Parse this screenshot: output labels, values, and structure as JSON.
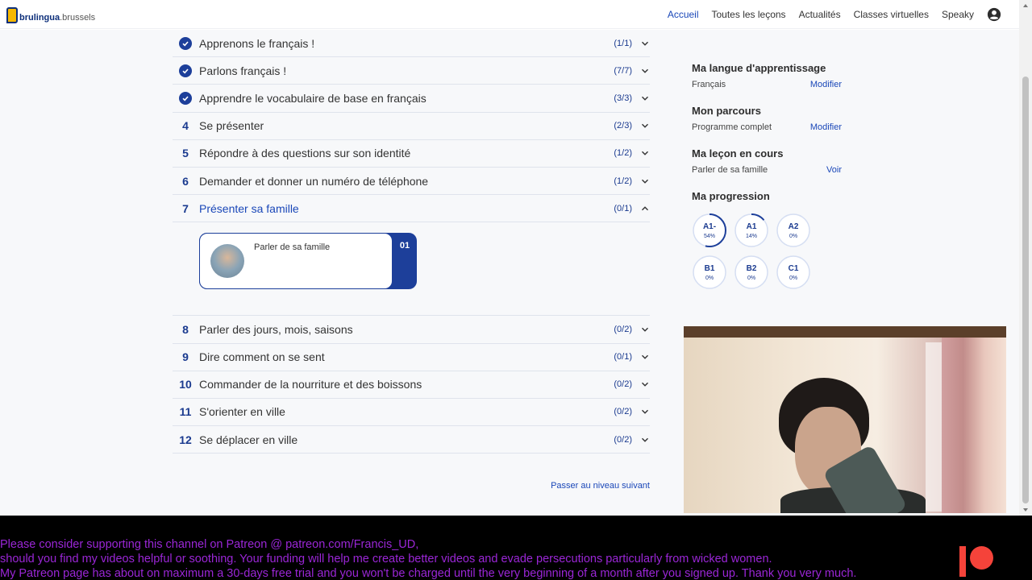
{
  "header": {
    "logo_name": "brulingua",
    "logo_suffix": ".brussels",
    "nav": [
      {
        "label": "Accueil",
        "active": true
      },
      {
        "label": "Toutes les leçons",
        "active": false
      },
      {
        "label": "Actualités",
        "active": false
      },
      {
        "label": "Classes virtuelles",
        "active": false
      },
      {
        "label": "Speaky",
        "active": false
      }
    ],
    "user_icon": "account-circle-icon"
  },
  "lessons": [
    {
      "num": "",
      "done": true,
      "title": "Apprenons le français !",
      "count": "(1/1)"
    },
    {
      "num": "",
      "done": true,
      "title": "Parlons français !",
      "count": "(7/7)"
    },
    {
      "num": "",
      "done": true,
      "title": "Apprendre le vocabulaire de base en français",
      "count": "(3/3)"
    },
    {
      "num": "4",
      "done": false,
      "title": "Se présenter",
      "count": "(2/3)"
    },
    {
      "num": "5",
      "done": false,
      "title": "Répondre à des questions sur son identité",
      "count": "(1/2)"
    },
    {
      "num": "6",
      "done": false,
      "title": "Demander et donner un numéro de téléphone",
      "count": "(1/2)"
    },
    {
      "num": "7",
      "done": false,
      "title": "Présenter sa famille",
      "count": "(0/1)",
      "expanded": true
    },
    {
      "num": "8",
      "done": false,
      "title": "Parler des jours, mois, saisons",
      "count": "(0/2)"
    },
    {
      "num": "9",
      "done": false,
      "title": "Dire comment on se sent",
      "count": "(0/1)"
    },
    {
      "num": "10",
      "done": false,
      "title": "Commander de la nourriture et des boissons",
      "count": "(0/2)"
    },
    {
      "num": "11",
      "done": false,
      "title": "S'orienter en ville",
      "count": "(0/2)"
    },
    {
      "num": "12",
      "done": false,
      "title": "Se déplacer en ville",
      "count": "(0/2)"
    }
  ],
  "expanded_card": {
    "title": "Parler de sa famille",
    "num": "01"
  },
  "next_level_label": "Passer au niveau suivant",
  "sidebar": {
    "language": {
      "heading": "Ma langue d'apprentissage",
      "value": "Français",
      "link": "Modifier"
    },
    "path": {
      "heading": "Mon parcours",
      "value": "Programme complet",
      "link": "Modifier"
    },
    "current": {
      "heading": "Ma leçon en cours",
      "value": "Parler de sa famille",
      "link": "Voir"
    },
    "progress": {
      "heading": "Ma progression",
      "levels": [
        {
          "label": "A1-",
          "percent_text": "54%",
          "percent": 54
        },
        {
          "label": "A1",
          "percent_text": "14%",
          "percent": 14
        },
        {
          "label": "A2",
          "percent_text": "0%",
          "percent": 0
        },
        {
          "label": "B1",
          "percent_text": "0%",
          "percent": 0
        },
        {
          "label": "B2",
          "percent_text": "0%",
          "percent": 0
        },
        {
          "label": "C1",
          "percent_text": "0%",
          "percent": 0
        }
      ]
    }
  },
  "overlay": {
    "lines": [
      "Please consider supporting this channel on Patreon @ patreon.com/Francis_UD,",
      "should you find my videos helpful or soothing. Your funding will help me create better videos and evade persecutions particularly from wicked women.",
      "My Patreon page has about on maximum a 30-days free trial and you won't be charged until the very beginning of a month after you signed up. Thank you very much."
    ],
    "text_color": "#9a26d6",
    "logo_icon": "patreon-logo-icon"
  },
  "colors": {
    "accent": "#1a47b8",
    "navy": "#1d3f9a",
    "ring_track": "#d5def2"
  }
}
